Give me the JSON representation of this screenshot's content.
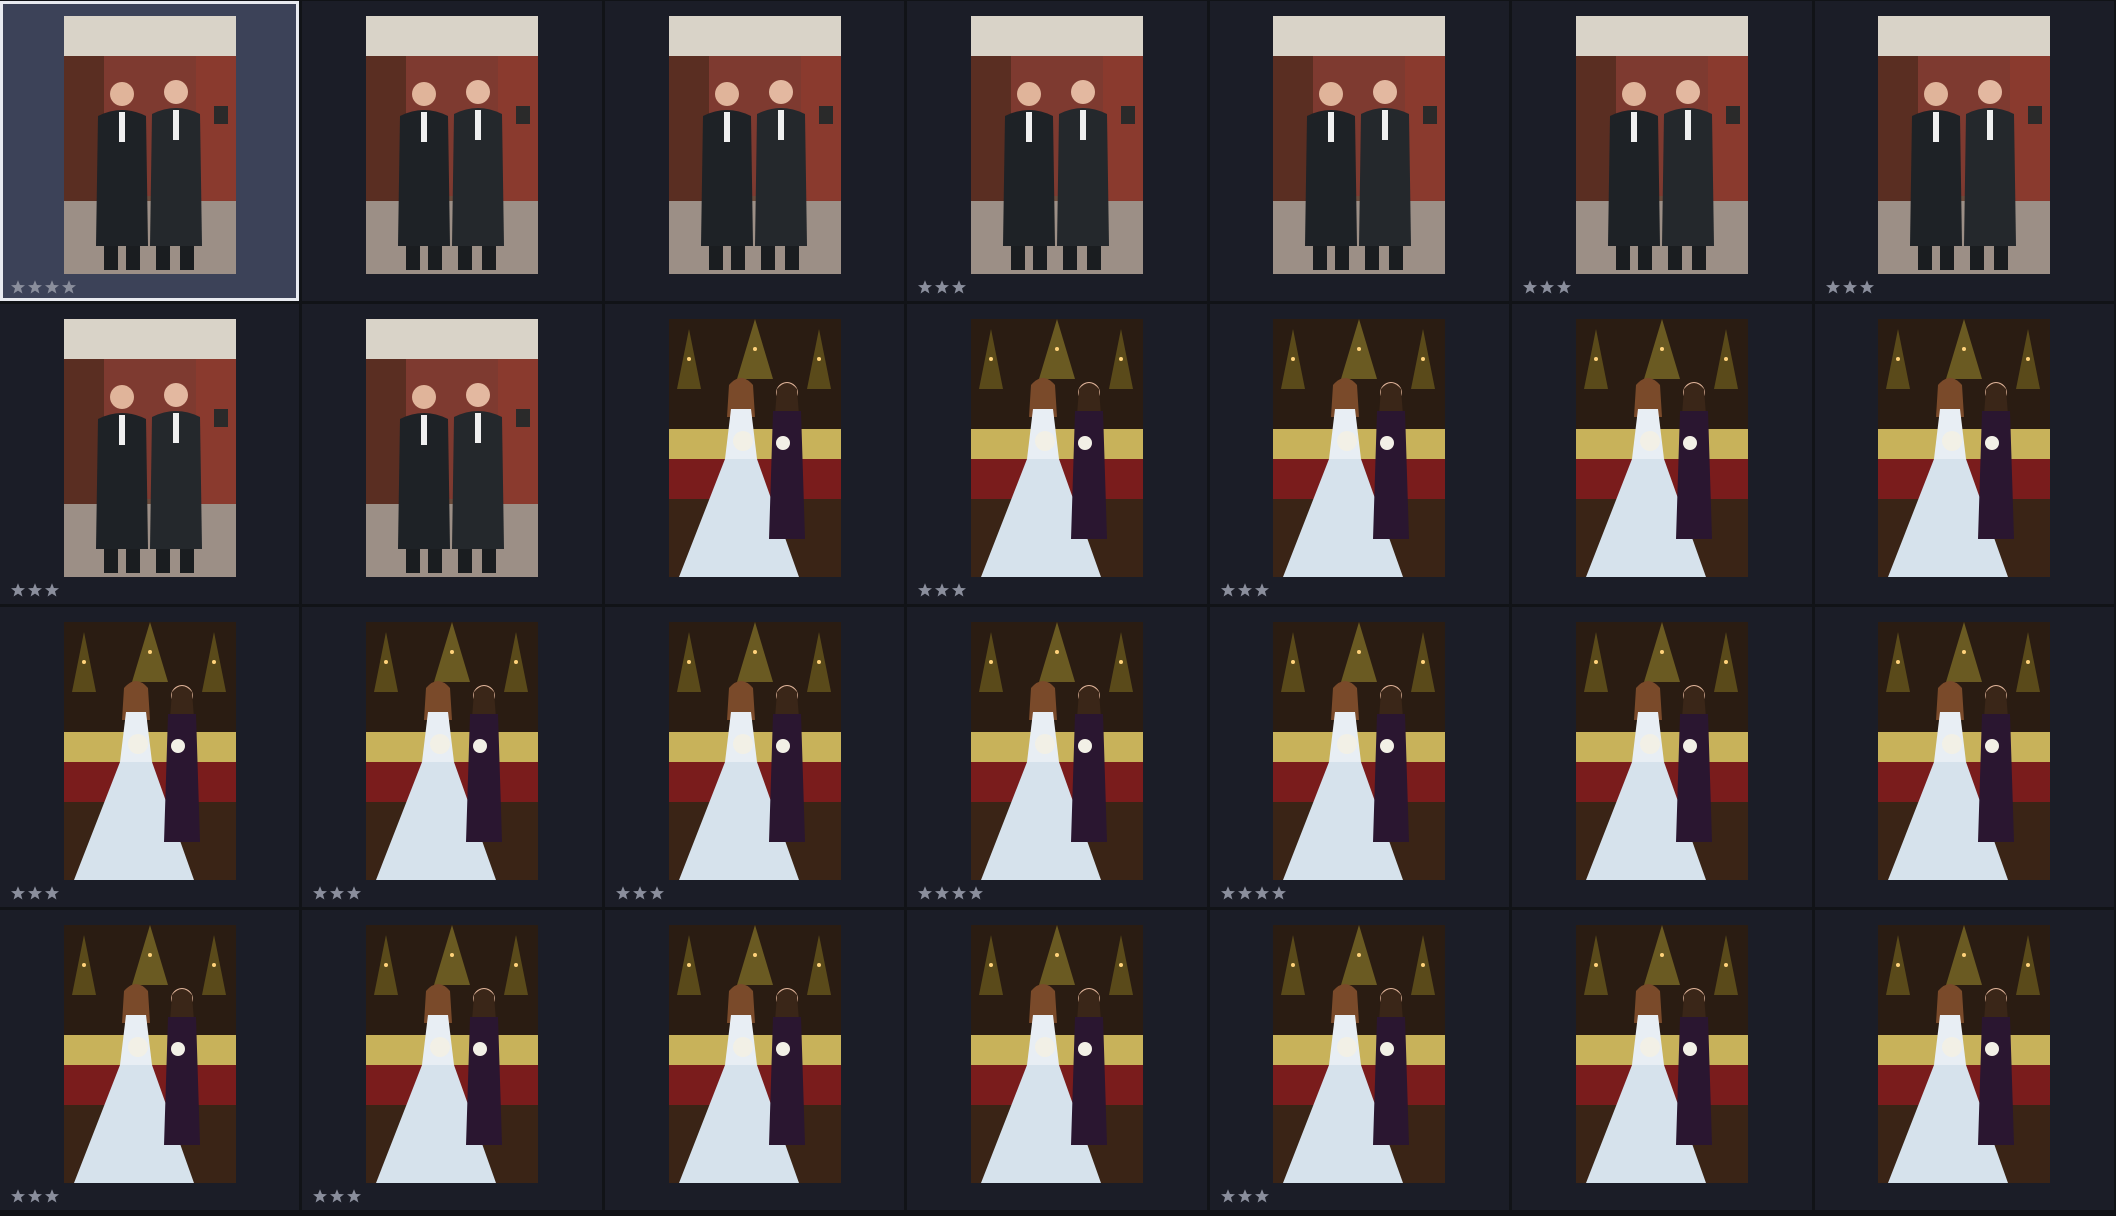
{
  "colors": {
    "cell_bg": "#1b1d27",
    "cell_selected_bg": "#3c4258",
    "selection_border": "#e8eaf0",
    "star": "#8a8e9c"
  },
  "thumbnails": [
    {
      "scene": "groomsmen",
      "rating": 4,
      "selected": true
    },
    {
      "scene": "groomsmen",
      "rating": 0,
      "selected": false
    },
    {
      "scene": "groomsmen",
      "rating": 0,
      "selected": false
    },
    {
      "scene": "groomsmen",
      "rating": 3,
      "selected": false
    },
    {
      "scene": "groomsmen",
      "rating": 0,
      "selected": false
    },
    {
      "scene": "groomsmen",
      "rating": 3,
      "selected": false
    },
    {
      "scene": "groomsmen",
      "rating": 3,
      "selected": false
    },
    {
      "scene": "groomsmen",
      "rating": 3,
      "selected": false
    },
    {
      "scene": "groomsmen",
      "rating": 0,
      "selected": false
    },
    {
      "scene": "bride",
      "rating": 0,
      "selected": false
    },
    {
      "scene": "bride",
      "rating": 3,
      "selected": false
    },
    {
      "scene": "bride",
      "rating": 3,
      "selected": false
    },
    {
      "scene": "bride",
      "rating": 0,
      "selected": false
    },
    {
      "scene": "bride",
      "rating": 0,
      "selected": false
    },
    {
      "scene": "bride",
      "rating": 3,
      "selected": false
    },
    {
      "scene": "bride",
      "rating": 3,
      "selected": false
    },
    {
      "scene": "bride",
      "rating": 3,
      "selected": false
    },
    {
      "scene": "bride",
      "rating": 4,
      "selected": false
    },
    {
      "scene": "bride",
      "rating": 4,
      "selected": false
    },
    {
      "scene": "bride",
      "rating": 0,
      "selected": false
    },
    {
      "scene": "bride",
      "rating": 0,
      "selected": false
    },
    {
      "scene": "bride",
      "rating": 3,
      "selected": false
    },
    {
      "scene": "bride",
      "rating": 3,
      "selected": false
    },
    {
      "scene": "bride",
      "rating": 0,
      "selected": false
    },
    {
      "scene": "bride",
      "rating": 0,
      "selected": false
    },
    {
      "scene": "bride",
      "rating": 3,
      "selected": false
    },
    {
      "scene": "bride",
      "rating": 0,
      "selected": false
    },
    {
      "scene": "bride",
      "rating": 0,
      "selected": false
    }
  ]
}
